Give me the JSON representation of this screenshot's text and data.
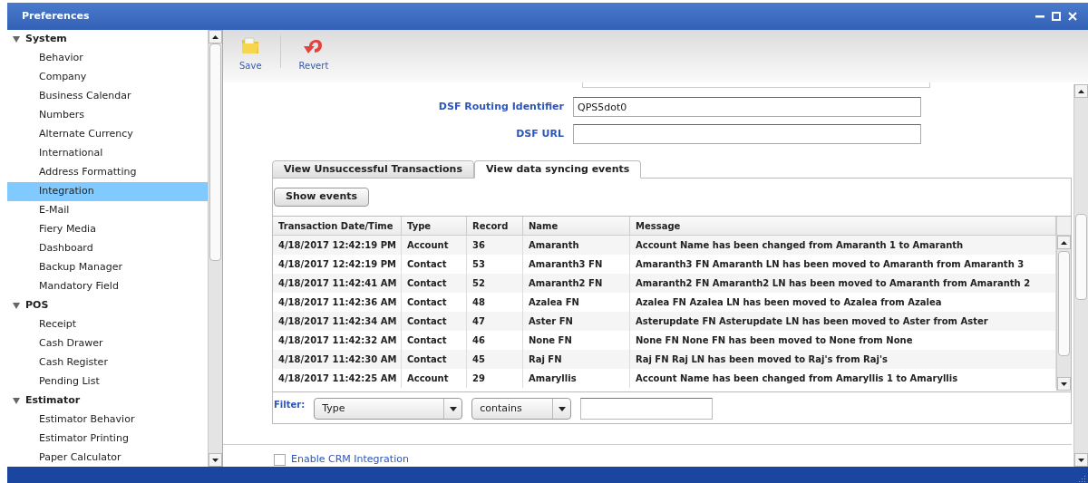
{
  "window": {
    "title": "Preferences"
  },
  "sidebar": {
    "groups": [
      {
        "label": "System",
        "expanded": true,
        "children": [
          {
            "label": "Behavior",
            "selected": false
          },
          {
            "label": "Company",
            "selected": false
          },
          {
            "label": "Business Calendar",
            "selected": false
          },
          {
            "label": "Numbers",
            "selected": false
          },
          {
            "label": "Alternate Currency",
            "selected": false
          },
          {
            "label": "International",
            "selected": false
          },
          {
            "label": "Address Formatting",
            "selected": false
          },
          {
            "label": "Integration",
            "selected": true
          },
          {
            "label": "E-Mail",
            "selected": false
          },
          {
            "label": "Fiery Media",
            "selected": false
          },
          {
            "label": "Dashboard",
            "selected": false
          },
          {
            "label": "Backup Manager",
            "selected": false
          },
          {
            "label": "Mandatory Field",
            "selected": false
          }
        ]
      },
      {
        "label": "POS",
        "expanded": true,
        "children": [
          {
            "label": "Receipt",
            "selected": false
          },
          {
            "label": "Cash Drawer",
            "selected": false
          },
          {
            "label": "Cash Register",
            "selected": false
          },
          {
            "label": "Pending List",
            "selected": false
          }
        ]
      },
      {
        "label": "Estimator",
        "expanded": true,
        "children": [
          {
            "label": "Estimator Behavior",
            "selected": false
          },
          {
            "label": "Estimator Printing",
            "selected": false
          },
          {
            "label": "Paper Calculator",
            "selected": false
          }
        ]
      }
    ]
  },
  "toolbar": [
    {
      "label": "Save",
      "kind": "save"
    },
    {
      "label": "Revert",
      "kind": "revert"
    }
  ],
  "fields": [
    {
      "label": "DSF Routing Identifier",
      "value": "QPS5dot0"
    },
    {
      "label": "DSF URL"
    }
  ],
  "tabs": [
    {
      "label": "View Unsuccessful Transactions",
      "selected": false
    },
    {
      "label": "View data syncing events",
      "selected": true
    }
  ],
  "show_events_button": "Show events",
  "table": {
    "columns": [
      "Transaction Date/Time",
      "Type",
      "Record",
      "Name",
      "Message"
    ],
    "rows": [
      [
        "4/18/2017 12:42:19 PM",
        "Account",
        "36",
        "Amaranth",
        "Account Name has been changed from Amaranth 1 to Amaranth"
      ],
      [
        "4/18/2017 12:42:19 PM",
        "Contact",
        "53",
        "Amaranth3 FN",
        "Amaranth3 FN Amaranth LN has been moved to Amaranth from Amaranth 3"
      ],
      [
        "4/18/2017 11:42:41 AM",
        "Contact",
        "52",
        "Amaranth2 FN",
        "Amaranth2 FN Amaranth2 LN has been moved to Amaranth from Amaranth 2"
      ],
      [
        "4/18/2017 11:42:36 AM",
        "Contact",
        "48",
        "Azalea FN",
        "Azalea FN Azalea LN has been moved to Azalea from Azalea"
      ],
      [
        "4/18/2017 11:42:34 AM",
        "Contact",
        "47",
        "Aster FN",
        "Asterupdate FN Asterupdate LN has been moved to Aster from Aster"
      ],
      [
        "4/18/2017 11:42:32 AM",
        "Contact",
        "46",
        "None FN",
        "None FN None FN has been moved to None from None"
      ],
      [
        "4/18/2017 11:42:30 AM",
        "Contact",
        "45",
        "Raj FN",
        "Raj FN Raj LN has been moved to Raj's from Raj's"
      ],
      [
        "4/18/2017 11:42:25 AM",
        "Account",
        "29",
        "Amaryllis",
        "Account Name has been changed from Amaryllis 1 to Amaryllis"
      ]
    ]
  },
  "filter": {
    "label": "Filter:",
    "field": "Type",
    "operator": "contains"
  },
  "crm": {
    "label": "Enable CRM Integration",
    "checked": false
  }
}
